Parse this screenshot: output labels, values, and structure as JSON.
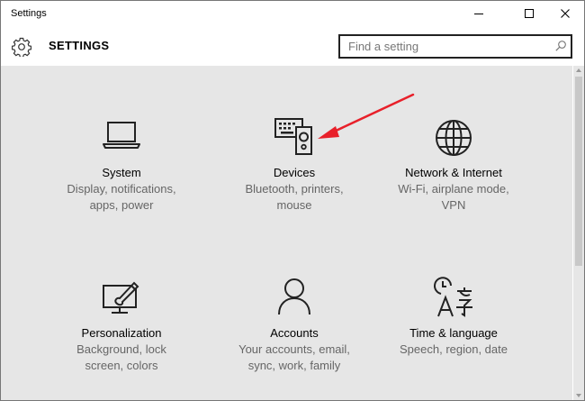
{
  "window": {
    "title": "Settings"
  },
  "header": {
    "title": "SETTINGS"
  },
  "search": {
    "placeholder": "Find a setting"
  },
  "tiles": [
    {
      "title": "System",
      "desc": "Display, notifications,\napps, power",
      "icon": "laptop-icon"
    },
    {
      "title": "Devices",
      "desc": "Bluetooth, printers,\nmouse",
      "icon": "devices-icon"
    },
    {
      "title": "Network & Internet",
      "desc": "Wi-Fi, airplane mode,\nVPN",
      "icon": "globe-icon"
    },
    {
      "title": "Personalization",
      "desc": "Background, lock\nscreen, colors",
      "icon": "paintbrush-monitor-icon"
    },
    {
      "title": "Accounts",
      "desc": "Your accounts, email,\nsync, work, family",
      "icon": "person-icon"
    },
    {
      "title": "Time & language",
      "desc": "Speech, region, date",
      "icon": "time-language-icon"
    }
  ],
  "colors": {
    "content_bg": "#e6e6e6",
    "annotation_arrow": "#e8202a"
  }
}
